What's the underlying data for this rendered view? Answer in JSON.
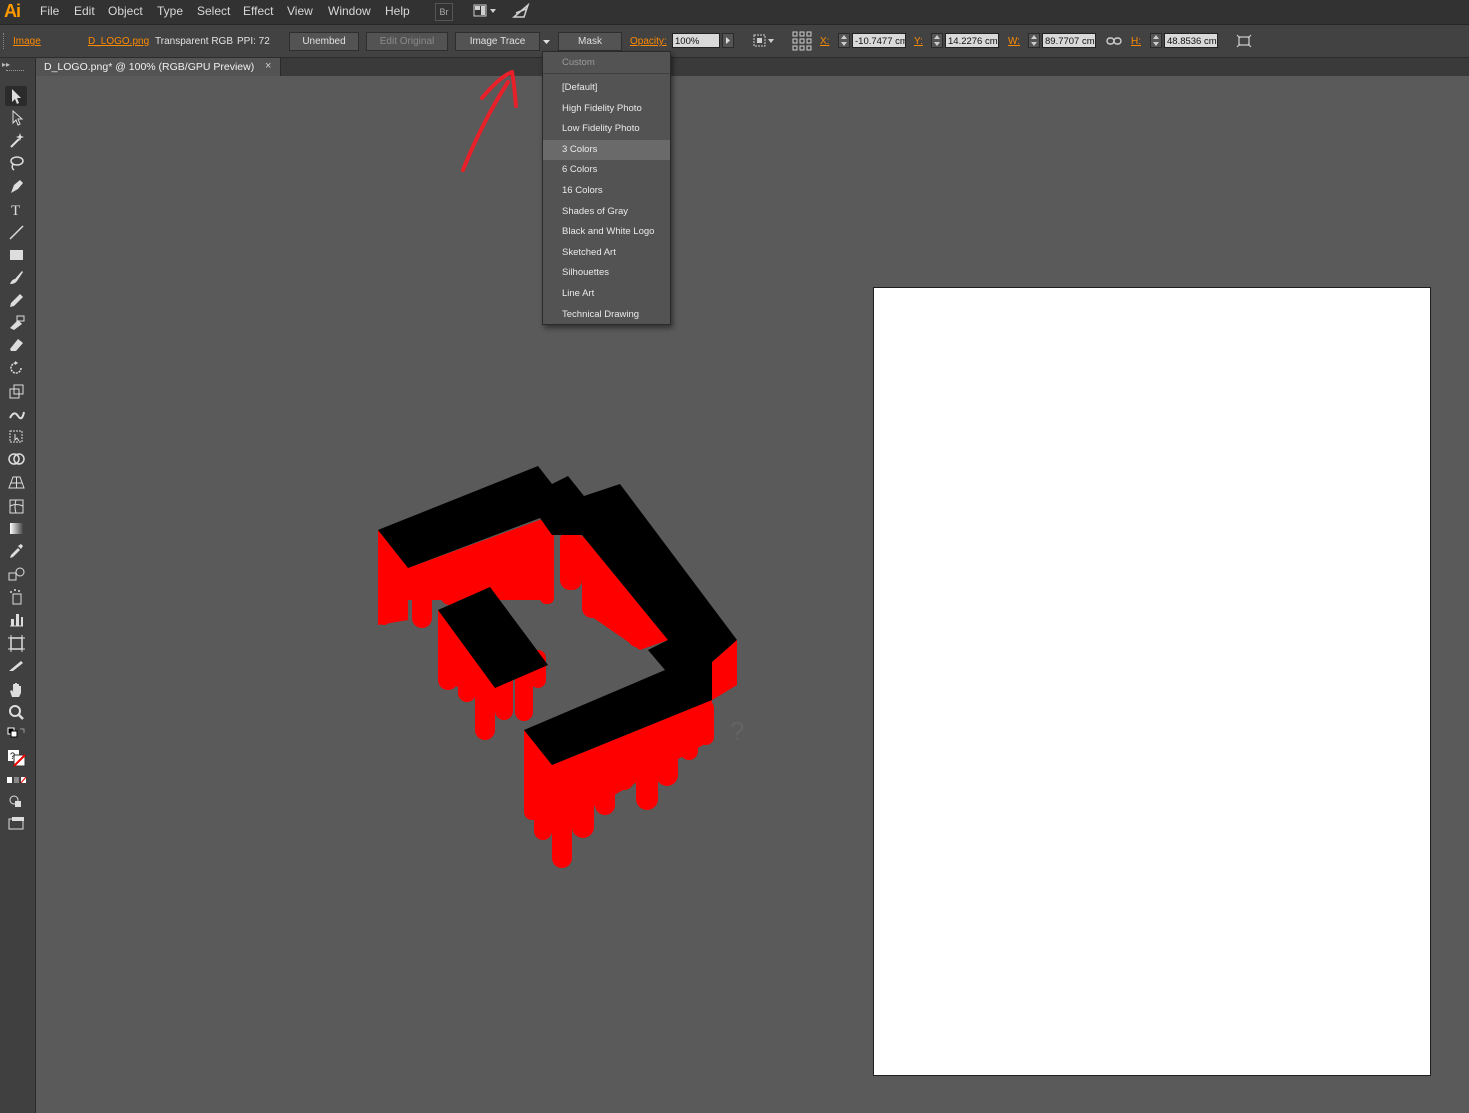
{
  "app": {
    "logo": "Ai"
  },
  "menubar": {
    "items": [
      "File",
      "Edit",
      "Object",
      "Type",
      "Select",
      "Effect",
      "View",
      "Window",
      "Help"
    ],
    "bridge_label": "Br"
  },
  "controlbar": {
    "object_type": "Image",
    "filename": "D_LOGO.png",
    "color_mode": "Transparent RGB",
    "ppi_label": "PPI: 72",
    "unembed_label": "Unembed",
    "edit_original_label": "Edit Original",
    "image_trace_label": "Image Trace",
    "mask_label": "Mask",
    "opacity_label": "Opacity:",
    "opacity_value": "100%",
    "x_label": "X:",
    "x_value": "-10.7477 cm",
    "y_label": "Y:",
    "y_value": "14.2276 cm",
    "w_label": "W:",
    "w_value": "89.7707 cm",
    "h_label": "H:",
    "h_value": "48.8536 cm"
  },
  "document_tab": {
    "title": "D_LOGO.png* @ 100% (RGB/GPU Preview)",
    "close_glyph": "×"
  },
  "tools": [
    "selection-tool",
    "direct-selection-tool",
    "magic-wand-tool",
    "lasso-tool",
    "pen-tool",
    "type-tool",
    "line-segment-tool",
    "rectangle-tool",
    "paintbrush-tool",
    "pencil-tool",
    "blob-brush-tool",
    "eraser-tool",
    "rotate-tool",
    "scale-tool",
    "warp-tool",
    "free-transform-tool",
    "shape-builder-tool",
    "perspective-grid-tool",
    "mesh-tool",
    "gradient-tool",
    "eyedropper-tool",
    "blend-tool",
    "symbol-sprayer-tool",
    "column-graph-tool",
    "artboard-tool",
    "slice-tool",
    "hand-tool",
    "zoom-tool"
  ],
  "preset_menu": {
    "header": "Custom",
    "items": [
      "[Default]",
      "High Fidelity Photo",
      "Low Fidelity Photo",
      "3 Colors",
      "6 Colors",
      "16 Colors",
      "Shades of Gray",
      "Black and White Logo",
      "Sketched Art",
      "Silhouettes",
      "Line Art",
      "Technical Drawing"
    ],
    "highlighted": "3 Colors"
  },
  "colors": {
    "accent": "#ff8a00",
    "artwork_black": "#000000",
    "artwork_red": "#ff0000",
    "annotation_red": "#e8202a",
    "canvas_bg": "#5a5a5a",
    "artboard": "#ffffff"
  }
}
